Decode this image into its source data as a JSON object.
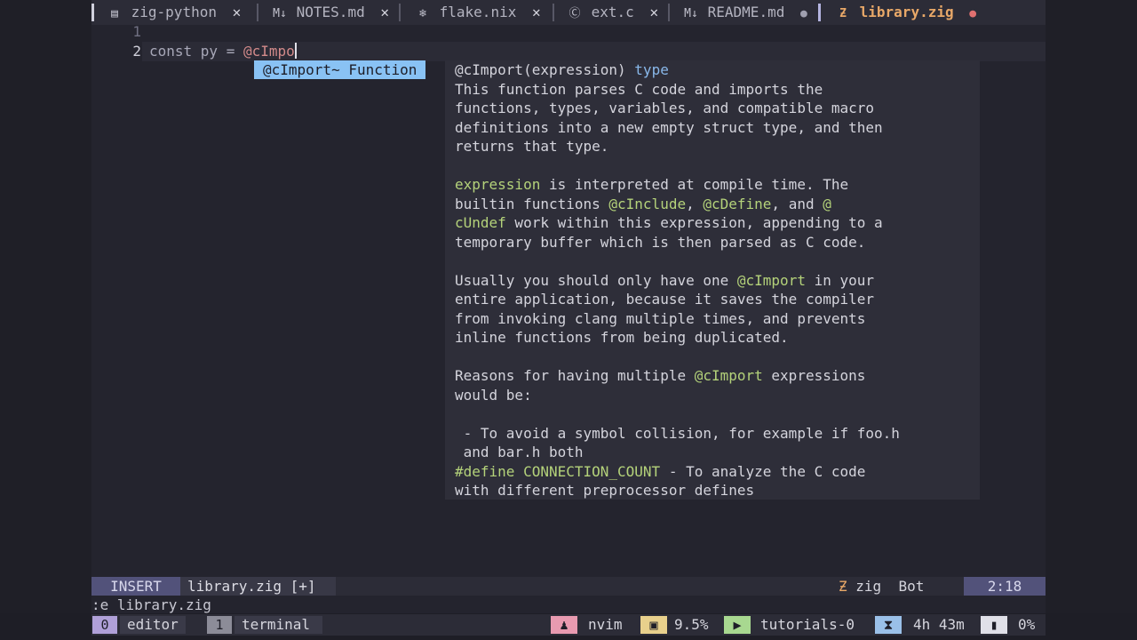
{
  "tabs": [
    {
      "icon": "document-icon",
      "glyph": "▤",
      "label": "zig-python",
      "marker": "✕"
    },
    {
      "icon": "markdown-icon",
      "glyph": "M↓",
      "label": "NOTES.md",
      "marker": "✕"
    },
    {
      "icon": "snowflake-icon",
      "glyph": "❄",
      "label": "flake.nix",
      "marker": "✕"
    },
    {
      "icon": "c-file-icon",
      "glyph": "Ⓒ",
      "label": "ext.c",
      "marker": "✕"
    },
    {
      "icon": "markdown-icon",
      "glyph": "M↓",
      "label": "README.md",
      "marker": "●"
    },
    {
      "icon": "zig-icon",
      "glyph": "Ƶ",
      "label": "library.zig",
      "marker": "●"
    }
  ],
  "editor": {
    "line1": "1",
    "line2": "2",
    "code_prefix": "const py = ",
    "code_typed": "@cImpo"
  },
  "completion": {
    "item": "@cImport~ Function"
  },
  "doc": {
    "signature": "@cImport(expression) ",
    "signature_kw": "type",
    "p1": [
      "This function parses C code and imports the",
      "functions, types, variables, and compatible macro",
      "definitions into a new empty struct type, and then",
      "returns that type."
    ],
    "p2_l1_hl": "expression",
    "p2_l1": " is interpreted at compile time. The",
    "p2_l2a": "builtin functions ",
    "p2_l2_hl1": "@cInclude",
    "p2_l2b": ", ",
    "p2_l2_hl2": "@cDefine",
    "p2_l2c": ", and ",
    "p2_l2_hl3": "@",
    "p2_l3_hl": "cUndef",
    "p2_l3": " work within this expression, appending to a",
    "p2_l4": "temporary buffer which is then parsed as C code.",
    "p3_l1a": "Usually you should only have one ",
    "p3_l1_hl": "@cImport",
    "p3_l1b": " in your",
    "p3_l2": "entire application, because it saves the compiler",
    "p3_l3": "from invoking clang multiple times, and prevents",
    "p3_l4": "inline functions from being duplicated.",
    "p4_l1a": "Reasons for having multiple ",
    "p4_l1_hl": "@cImport",
    "p4_l1b": " expressions",
    "p4_l2": "would be:",
    "li1_l1": " - To avoid a symbol collision, for example if foo.h",
    "li1_l2": " and bar.h both",
    "li2_hl": "#define CONNECTION_COUNT",
    "li2_l1": " - To analyze the C code",
    "li2_l2": "with different preprocessor defines"
  },
  "statusline": {
    "mode": "INSERT",
    "file": "library.zig [+]",
    "filetype": "zig",
    "scroll": "Bot",
    "position": "2:18"
  },
  "cmdline": ":e library.zig",
  "tmux": {
    "win0_index": "0",
    "win0_name": "editor",
    "win1_index": "1",
    "win1_name": "terminal",
    "process": "nvim",
    "cpu": "9.5%",
    "session": "tutorials-0",
    "uptime": "4h 43m",
    "battery": "0%"
  }
}
